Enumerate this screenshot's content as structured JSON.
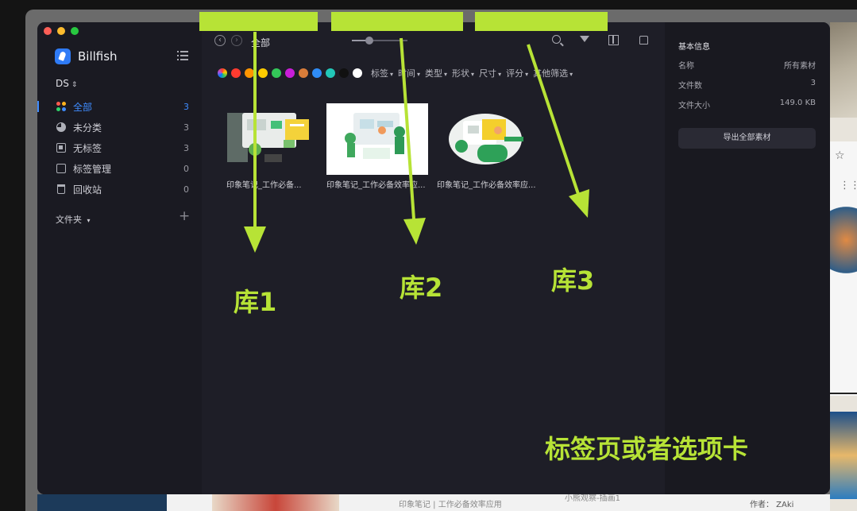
{
  "app": {
    "name": "Billfish",
    "library": "DS"
  },
  "sidebar": {
    "items": [
      {
        "label": "全部",
        "count": "3",
        "active": true
      },
      {
        "label": "未分类",
        "count": "3"
      },
      {
        "label": "无标签",
        "count": "3"
      },
      {
        "label": "标签管理",
        "count": "0"
      },
      {
        "label": "回收站",
        "count": "0"
      }
    ],
    "folders_label": "文件夹",
    "folders_add": "+"
  },
  "toolbar": {
    "back": "‹",
    "forward": "›",
    "breadcrumb": "全部"
  },
  "filters": {
    "colors": [
      "#ff3b30",
      "#ff9500",
      "#ffcc00",
      "#34c759",
      "#c81ed8",
      "#d97d3a",
      "#2f8cf6",
      "#22c7b8",
      "#111111",
      "#ffffff"
    ],
    "dropdowns": [
      "标签",
      "时间",
      "类型",
      "形状",
      "尺寸",
      "评分",
      "其他筛选"
    ],
    "caret": "▾"
  },
  "items": [
    {
      "caption": "印象笔记_工作必备..."
    },
    {
      "caption": "印象笔记_工作必备效率应..."
    },
    {
      "caption": "印象笔记_工作必备效率应..."
    }
  ],
  "info": {
    "title": "基本信息",
    "rows": [
      {
        "key": "名称",
        "value": "所有素材"
      },
      {
        "key": "文件数",
        "value": "3"
      },
      {
        "key": "文件大小",
        "value": "149.0 KB"
      }
    ],
    "export_label": "导出全部素材"
  },
  "annotations": {
    "lib1": "库1",
    "lib2": "库2",
    "lib3": "库3",
    "tabs": "标签页或者选项卡",
    "color": "#b7e336"
  },
  "background": {
    "caption1": "印象笔记 | 工作必备效率应用",
    "caption2": "小熊观察-插画1",
    "author": "作者： ZAki",
    "star": "☆",
    "grid": "⋮⋮"
  }
}
